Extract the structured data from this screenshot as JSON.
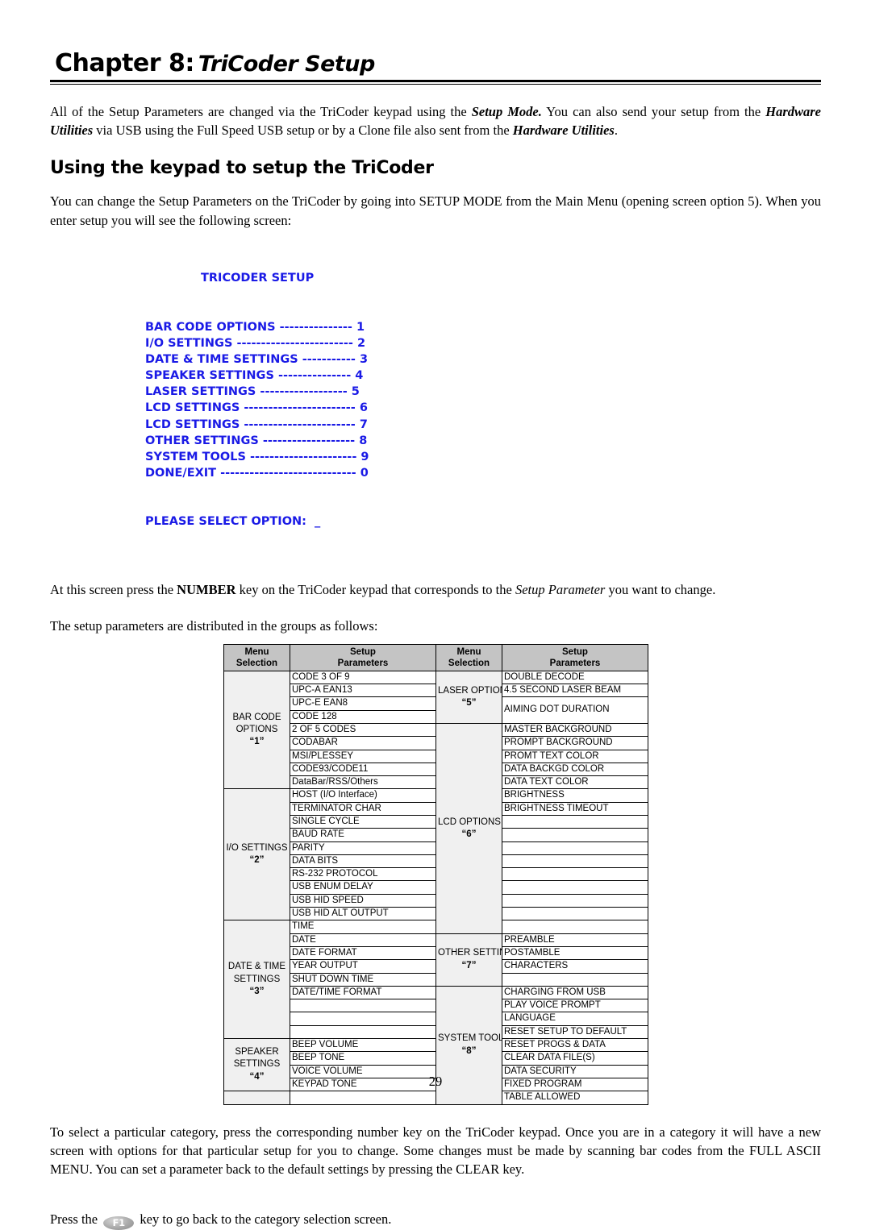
{
  "header": {
    "chapter_label": "Chapter 8:",
    "chapter_title": "TriCoder Setup"
  },
  "intro": {
    "line1_a": "All of the Setup Parameters are changed via the TriCoder keypad using the ",
    "line1_b": "Setup Mode.",
    "line1_c": " You can also send your setup from the ",
    "line2_a": "Hardware Utilities",
    "line2_b": " via USB using the Full Speed USB setup or by a Clone file also sent from the ",
    "line2_c": "Hardware Utilities",
    "line2_d": "."
  },
  "section": {
    "title": "Using the keypad to setup the TriCoder",
    "paragraph": "You can change the Setup Parameters on the TriCoder by going into SETUP MODE from the Main Menu (opening screen option 5). When you enter setup you will see the following screen:"
  },
  "lcd_screen": {
    "color": "#1a1ae6",
    "title": "TRICODER SETUP",
    "rows": [
      {
        "label": "BAR CODE OPTIONS",
        "dashes": " --------------- ",
        "number": "1"
      },
      {
        "label": "I/O SETTINGS",
        "dashes": " ------------------------ ",
        "number": "2"
      },
      {
        "label": "DATE & TIME SETTINGS",
        "dashes": " ----------- ",
        "number": "3"
      },
      {
        "label": "SPEAKER SETTINGS",
        "dashes": " --------------- ",
        "number": "4"
      },
      {
        "label": "LASER SETTINGS",
        "dashes": " ------------------ ",
        "number": "5"
      },
      {
        "label": "LCD SETTINGS",
        "dashes": " ----------------------- ",
        "number": "6"
      },
      {
        "label": "LCD SETTINGS",
        "dashes": " ----------------------- ",
        "number": "7"
      },
      {
        "label": "OTHER SETTINGS",
        "dashes": " ------------------- ",
        "number": "8"
      },
      {
        "label": "SYSTEM TOOLS",
        "dashes": " ---------------------- ",
        "number": "9"
      },
      {
        "label": "DONE/EXIT",
        "dashes": " ---------------------------- ",
        "number": "0"
      }
    ],
    "prompt": "PLEASE SELECT OPTION:  _"
  },
  "mid": {
    "para_a": "At this screen press the ",
    "para_b": "NUMBER",
    "para_c": " key on the TriCoder keypad that corresponds to the ",
    "para_d": "Setup Parameter",
    "para_e": " you want to change.",
    "para2": "The setup parameters are distributed in the groups as follows:"
  },
  "table": {
    "headers": {
      "menu_l1": "Menu",
      "menu_l2": "Selection",
      "setup_l1": "Setup",
      "setup_l2": "Parameters"
    },
    "left_groups": [
      {
        "lines": [
          "BAR CODE",
          "OPTIONS"
        ],
        "number": "“1”",
        "params": [
          "CODE 3 OF 9",
          "UPC-A  EAN13",
          "UPC-E  EAN8",
          "CODE 128",
          "2 OF 5 CODES",
          "CODABAR",
          "MSI/PLESSEY",
          "CODE93/CODE11",
          "DataBar/RSS/Others"
        ]
      },
      {
        "lines": [
          "I/O SETTINGS"
        ],
        "number": "“2”",
        "params": [
          "HOST (I/O Interface)",
          "TERMINATOR CHAR",
          "SINGLE CYCLE",
          "BAUD RATE",
          "PARITY",
          "DATA BITS",
          "RS-232 PROTOCOL",
          "USB ENUM DELAY",
          "USB HID SPEED",
          "USB HID ALT OUTPUT"
        ]
      },
      {
        "lines": [
          "DATE & TIME",
          "SETTINGS"
        ],
        "number": "“3”",
        "params": [
          "TIME",
          "DATE",
          "DATE FORMAT",
          "YEAR OUTPUT",
          "SHUT DOWN TIME",
          "DATE/TIME FORMAT",
          "",
          "",
          ""
        ]
      },
      {
        "lines": [
          "SPEAKER",
          "SETTINGS"
        ],
        "number": "“4”",
        "params": [
          "BEEP VOLUME",
          "BEEP TONE",
          "VOICE VOLUME",
          "KEYPAD TONE"
        ]
      }
    ],
    "right_groups": [
      {
        "lines": [
          "LASER OPTIONS"
        ],
        "number": "“5”",
        "params": [
          "DOUBLE DECODE",
          "4.5 SECOND LASER BEAM",
          "AIMING DOT DURATION"
        ],
        "tall_last": true
      },
      {
        "lines": [
          "LCD OPTIONS"
        ],
        "number": "“6”",
        "params": [
          "MASTER BACKGROUND",
          "PROMPT BACKGROUND",
          "PROMT TEXT COLOR",
          "DATA BACKGD COLOR",
          "DATA TEXT COLOR",
          "BRIGHTNESS",
          "BRIGHTNESS TIMEOUT",
          "",
          "",
          "",
          "",
          "",
          "",
          "",
          "",
          ""
        ]
      },
      {
        "lines": [
          "OTHER SETTINGS"
        ],
        "number": "“7”",
        "params": [
          "PREAMBLE",
          "POSTAMBLE",
          "CHARACTERS",
          ""
        ]
      },
      {
        "lines": [
          "SYSTEM TOOLS"
        ],
        "number": "“8”",
        "params": [
          "CHARGING FROM USB",
          "PLAY VOICE PROMPT",
          "LANGUAGE",
          "RESET SETUP TO DEFAULT",
          "RESET PROGS & DATA",
          "CLEAR DATA FILE(S)",
          "DATA SECURITY",
          "FIXED PROGRAM",
          "TABLE ALLOWED"
        ]
      }
    ]
  },
  "footer_text": {
    "para1": "To select a particular category, press the corresponding number key on the TriCoder keypad.  Once you are in a category it will have a new screen with options for that particular setup for you to change. Some changes must be made by scanning bar codes from the FULL ASCII MENU. You can set a parameter back to the default settings by pressing the CLEAR key.",
    "f1_pre": "Press the ",
    "f1_key": "F1",
    "f1_post": " key to go back to the category selection screen."
  },
  "page_number": "29"
}
